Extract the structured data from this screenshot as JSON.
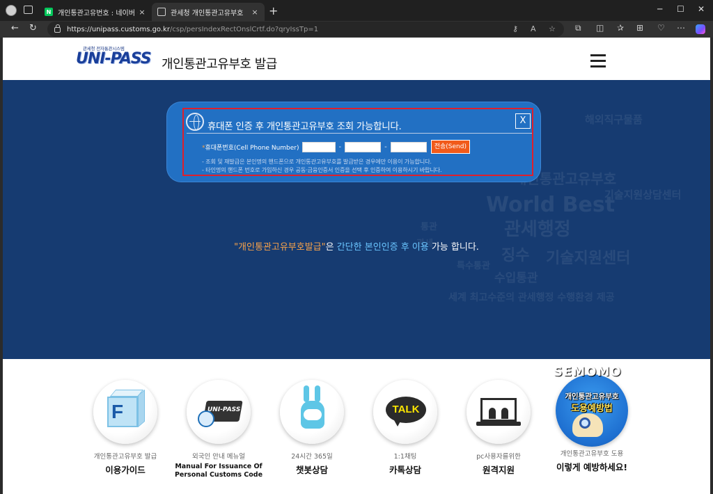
{
  "browser": {
    "tabs": [
      {
        "title": "개인통관고유번호 : 네이버 검색",
        "favicon": "N"
      },
      {
        "title": "관세청 개인통관고유부호",
        "active": true
      }
    ],
    "url_domain": "https://unipass.customs.go.kr",
    "url_path": "/csp/persIndexRectOnslCrtf.do?qryIssTp=1",
    "icons": {
      "back": "←",
      "refresh": "↻",
      "tab_close": "×",
      "new_tab": "+",
      "minimize": "─",
      "maximize": "☐",
      "close_window": "✕",
      "key": "⚷",
      "read_aloud": "A",
      "favorite": "☆",
      "extensions": "⧉",
      "split": "◫",
      "favorites": "✰",
      "collections": "⊞",
      "performance": "♡",
      "more": "⋯"
    }
  },
  "site": {
    "logo_sub": "관세청 전자통관시스템",
    "logo_main": "UNI-PASS",
    "title": "개인통관고유부호 발급"
  },
  "background_words": [
    "해외직구물품",
    "기술지원상담센터",
    "World Best",
    "관세행정",
    "징수",
    "기술지원센터",
    "수입통관",
    "특수통관",
    "세계 최고수준의 관세행정 수행환경 제공",
    "개인통관고유부호",
    "관세",
    "통관"
  ],
  "modal": {
    "title": "휴대폰 인증 후 개인통관고유부호 조회 가능합니다.",
    "close_label": "X",
    "phone_label_star": "*",
    "phone_label": "휴대폰번호(Cell Phone Number)",
    "phone_part1": "",
    "phone_part2": "",
    "phone_part3": "",
    "dash": "-",
    "send_label": "전송(Send)",
    "note1": "- 조회 및 재발급은 본인명의 핸드폰으로 개인통관고유부호를 발급받은 경우에만 이용이 가능합니다.",
    "note2": "- 타인명의 핸드폰 번호로 가입하신 경우 공동·금융인증서 인증을 선택 후 인증하여 이용하시기 바랍니다."
  },
  "info_line": {
    "part1": "\"개인통관고유부호발급\"",
    "part2": "은 ",
    "part3": "간단한 본인인증 후 이용",
    "part4": " 가능 합니다."
  },
  "services": [
    {
      "sub": "개인통관고유부호 발급",
      "main": "이용가이드",
      "icon": "cube-f-icon"
    },
    {
      "sub": "외국인 안내 메뉴얼",
      "main": "Manual For Issuance Of Personal Customs Code",
      "icon": "manual-book-icon",
      "book_text": "UNI-PASS"
    },
    {
      "sub": "24시간 365일",
      "main": "챗봇상담",
      "icon": "chatbot-bunny-icon"
    },
    {
      "sub": "1:1채팅",
      "main": "카톡상담",
      "icon": "kakaotalk-icon",
      "talk_text": "TALK"
    },
    {
      "sub": "pc사용자를위한",
      "main": "원격지원",
      "icon": "remote-monitor-icon"
    },
    {
      "sub": "개인통관고유부호 도용",
      "main": "이렇게 예방하세요!",
      "icon": "theft-prevention-icon",
      "promo_line1": "개인통관고유부호",
      "promo_line2": "도용예방법"
    }
  ],
  "watermark": "SEMOMO",
  "colors": {
    "hero_bg": "#163b71",
    "modal_bg": "#2270c3",
    "highlight_border": "#e01f2b",
    "send_button": "#f15a1a",
    "accent_orange": "#f7a24a",
    "accent_cyan": "#6ac5ff"
  }
}
